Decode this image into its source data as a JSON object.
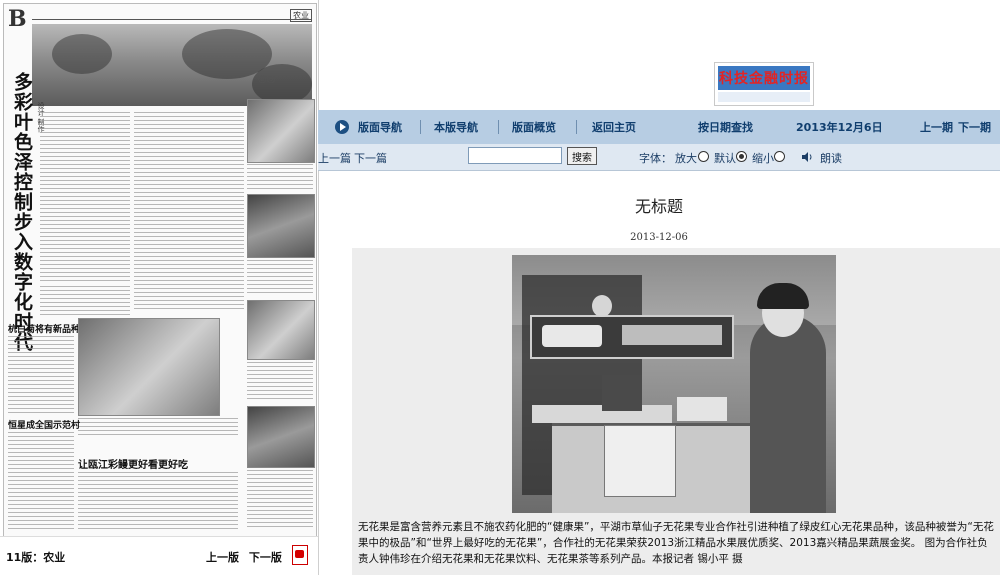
{
  "paper": {
    "page_letter": "B",
    "page_tag": "农业",
    "headline_vertical": "多彩叶色泽控制步入数字化时代",
    "subhead_vertical": "设计   制作",
    "section_headline_1": "杭白菊将有新品种",
    "section_headline_2": "恒星成全国示范村",
    "section_headline_3": "让瓯江彩鳗更好看更好吃",
    "edition_label": "11版：农业",
    "prev_page": "上一版",
    "next_page": "下一版"
  },
  "site": {
    "logo_text": "科技金融时报",
    "nav": {
      "items": [
        "版面导航",
        "本版导航",
        "版面概览",
        "返回主页"
      ],
      "date_search": "按日期查找",
      "current_date": "2013年12月6日",
      "prev_issue": "上一期",
      "next_issue": "下一期"
    },
    "toolbar": {
      "prev_article": "上一篇",
      "next_article": "下一篇",
      "search_value": "",
      "search_button": "搜索",
      "font_label": "字体：",
      "font_large": "放大",
      "font_default": "默认",
      "font_small": "缩小",
      "read_aloud": "朗读"
    },
    "article": {
      "title": "无标题",
      "date": "2013-12-06",
      "caption": "无花果是富含营养元素且不施农药化肥的“健康果”，平湖市草仙子无花果专业合作社引进种植了绿皮红心无花果品种，该品种被誉为“无花果中的极品”和“世界上最好吃的无花果”，合作社的无花果荣获2013浙江精品水果展优质奖、2013嘉兴精品果蔬展金奖。 图为合作社负责人钟伟珍在介绍无花果和无花果饮料、无花果茶等系列产品。本报记者 锡小平 摄"
    },
    "colors": {
      "nav_bg": "#b7cde3",
      "toolbar_bg": "#dfe8f2",
      "nav_text": "#103e6e",
      "logo_red": "#e32424",
      "logo_blue": "#3a78c2"
    }
  }
}
